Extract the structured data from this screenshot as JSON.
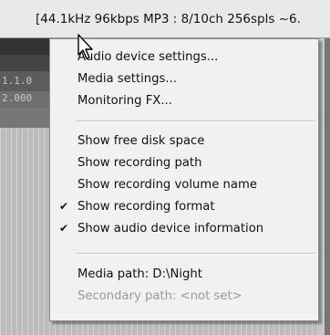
{
  "status_bar": {
    "text": "[44.1kHz 96kbps MP3 : 8/10ch 256spls ~6."
  },
  "background": {
    "labels": [
      "1.1.0",
      "2.000"
    ]
  },
  "menu": {
    "items": [
      {
        "label": "Audio device settings...",
        "checked": false,
        "enabled": true
      },
      {
        "label": "Media settings...",
        "checked": false,
        "enabled": true
      },
      {
        "label": "Monitoring FX...",
        "checked": false,
        "enabled": true
      },
      {
        "label": "Show free disk space",
        "checked": false,
        "enabled": true
      },
      {
        "label": "Show recording path",
        "checked": false,
        "enabled": true
      },
      {
        "label": "Show recording volume name",
        "checked": false,
        "enabled": true
      },
      {
        "label": "Show recording format",
        "checked": true,
        "enabled": true
      },
      {
        "label": "Show audio device information",
        "checked": true,
        "enabled": true
      },
      {
        "label": "Media path: D:\\Night",
        "checked": false,
        "enabled": true
      },
      {
        "label": "Secondary path: <not set>",
        "checked": false,
        "enabled": false
      }
    ],
    "check_glyph": "✔"
  }
}
